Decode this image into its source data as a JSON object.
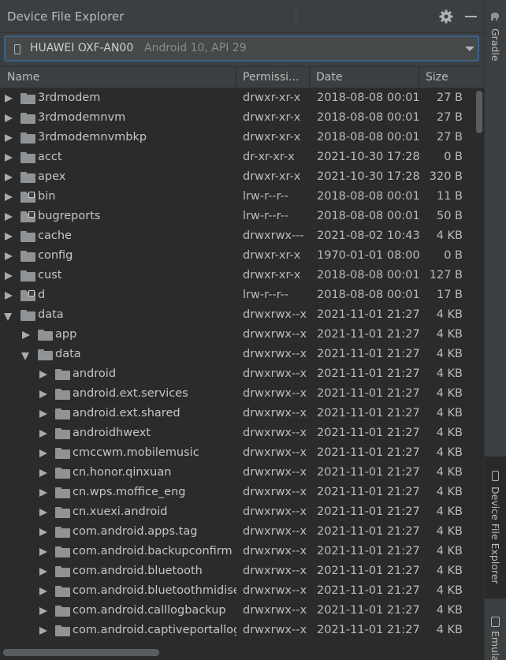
{
  "panel": {
    "title": "Device File Explorer"
  },
  "device": {
    "name": "HUAWEI OXF-AN00",
    "detail": "Android 10, API 29"
  },
  "columns": {
    "name": "Name",
    "permissions": "Permissi...",
    "date": "Date",
    "size": "Size"
  },
  "rows": [
    {
      "name": "3rdmodem",
      "depth": 0,
      "expanded": false,
      "link": false,
      "perm": "drwxr-xr-x",
      "date": "2018-08-08 00:01",
      "size": "27 B"
    },
    {
      "name": "3rdmodemnvm",
      "depth": 0,
      "expanded": false,
      "link": false,
      "perm": "drwxr-xr-x",
      "date": "2018-08-08 00:01",
      "size": "27 B"
    },
    {
      "name": "3rdmodemnvmbkp",
      "depth": 0,
      "expanded": false,
      "link": false,
      "perm": "drwxr-xr-x",
      "date": "2018-08-08 00:01",
      "size": "27 B"
    },
    {
      "name": "acct",
      "depth": 0,
      "expanded": false,
      "link": false,
      "perm": "dr-xr-xr-x",
      "date": "2021-10-30 17:28",
      "size": "0 B"
    },
    {
      "name": "apex",
      "depth": 0,
      "expanded": false,
      "link": false,
      "perm": "drwxr-xr-x",
      "date": "2021-10-30 17:28",
      "size": "320 B"
    },
    {
      "name": "bin",
      "depth": 0,
      "expanded": false,
      "link": true,
      "perm": "lrw-r--r--",
      "date": "2018-08-08 00:01",
      "size": "11 B"
    },
    {
      "name": "bugreports",
      "depth": 0,
      "expanded": false,
      "link": true,
      "perm": "lrw-r--r--",
      "date": "2018-08-08 00:01",
      "size": "50 B"
    },
    {
      "name": "cache",
      "depth": 0,
      "expanded": false,
      "link": false,
      "perm": "drwxrwx---",
      "date": "2021-08-02 10:43",
      "size": "4 KB"
    },
    {
      "name": "config",
      "depth": 0,
      "expanded": false,
      "link": false,
      "perm": "drwxr-xr-x",
      "date": "1970-01-01 08:00",
      "size": "0 B"
    },
    {
      "name": "cust",
      "depth": 0,
      "expanded": false,
      "link": false,
      "perm": "drwxr-xr-x",
      "date": "2018-08-08 00:01",
      "size": "127 B"
    },
    {
      "name": "d",
      "depth": 0,
      "expanded": false,
      "link": true,
      "perm": "lrw-r--r--",
      "date": "2018-08-08 00:01",
      "size": "17 B"
    },
    {
      "name": "data",
      "depth": 0,
      "expanded": true,
      "link": false,
      "perm": "drwxrwx--x",
      "date": "2021-11-01 21:27",
      "size": "4 KB"
    },
    {
      "name": "app",
      "depth": 1,
      "expanded": false,
      "link": false,
      "perm": "drwxrwx--x",
      "date": "2021-11-01 21:27",
      "size": "4 KB"
    },
    {
      "name": "data",
      "depth": 1,
      "expanded": true,
      "link": false,
      "perm": "drwxrwx--x",
      "date": "2021-11-01 21:27",
      "size": "4 KB"
    },
    {
      "name": "android",
      "depth": 2,
      "expanded": false,
      "link": false,
      "perm": "drwxrwx--x",
      "date": "2021-11-01 21:27",
      "size": "4 KB"
    },
    {
      "name": "android.ext.services",
      "depth": 2,
      "expanded": false,
      "link": false,
      "perm": "drwxrwx--x",
      "date": "2021-11-01 21:27",
      "size": "4 KB"
    },
    {
      "name": "android.ext.shared",
      "depth": 2,
      "expanded": false,
      "link": false,
      "perm": "drwxrwx--x",
      "date": "2021-11-01 21:27",
      "size": "4 KB"
    },
    {
      "name": "androidhwext",
      "depth": 2,
      "expanded": false,
      "link": false,
      "perm": "drwxrwx--x",
      "date": "2021-11-01 21:27",
      "size": "4 KB"
    },
    {
      "name": "cmccwm.mobilemusic",
      "depth": 2,
      "expanded": false,
      "link": false,
      "perm": "drwxrwx--x",
      "date": "2021-11-01 21:27",
      "size": "4 KB"
    },
    {
      "name": "cn.honor.qinxuan",
      "depth": 2,
      "expanded": false,
      "link": false,
      "perm": "drwxrwx--x",
      "date": "2021-11-01 21:27",
      "size": "4 KB"
    },
    {
      "name": "cn.wps.moffice_eng",
      "depth": 2,
      "expanded": false,
      "link": false,
      "perm": "drwxrwx--x",
      "date": "2021-11-01 21:27",
      "size": "4 KB"
    },
    {
      "name": "cn.xuexi.android",
      "depth": 2,
      "expanded": false,
      "link": false,
      "perm": "drwxrwx--x",
      "date": "2021-11-01 21:27",
      "size": "4 KB"
    },
    {
      "name": "com.android.apps.tag",
      "depth": 2,
      "expanded": false,
      "link": false,
      "perm": "drwxrwx--x",
      "date": "2021-11-01 21:27",
      "size": "4 KB"
    },
    {
      "name": "com.android.backupconfirm",
      "depth": 2,
      "expanded": false,
      "link": false,
      "perm": "drwxrwx--x",
      "date": "2021-11-01 21:27",
      "size": "4 KB"
    },
    {
      "name": "com.android.bluetooth",
      "depth": 2,
      "expanded": false,
      "link": false,
      "perm": "drwxrwx--x",
      "date": "2021-11-01 21:27",
      "size": "4 KB"
    },
    {
      "name": "com.android.bluetoothmidiservice",
      "depth": 2,
      "expanded": false,
      "link": false,
      "perm": "drwxrwx--x",
      "date": "2021-11-01 21:27",
      "size": "4 KB"
    },
    {
      "name": "com.android.calllogbackup",
      "depth": 2,
      "expanded": false,
      "link": false,
      "perm": "drwxrwx--x",
      "date": "2021-11-01 21:27",
      "size": "4 KB"
    },
    {
      "name": "com.android.captiveportallogin",
      "depth": 2,
      "expanded": false,
      "link": false,
      "perm": "drwxrwx--x",
      "date": "2021-11-01 21:27",
      "size": "4 KB"
    }
  ],
  "side_tabs": {
    "gradle": "Gradle",
    "device_file_explorer": "Device File Explorer",
    "emulator": "Emulator"
  }
}
